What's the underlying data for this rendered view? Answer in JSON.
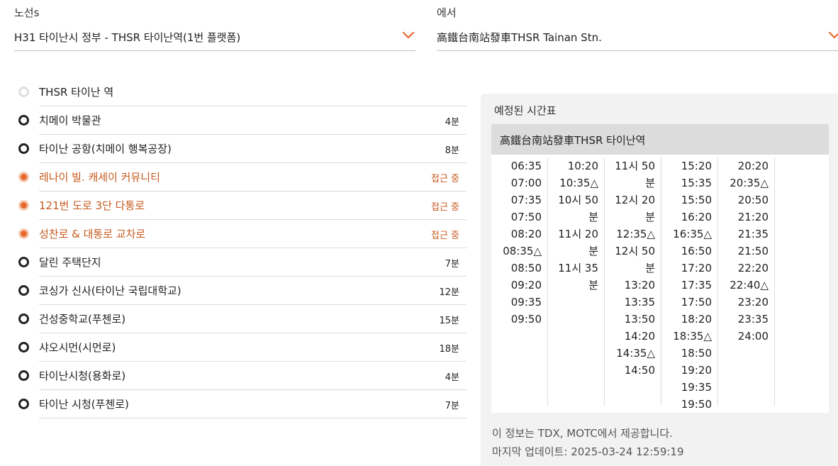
{
  "route_select": {
    "label": "노선s",
    "value": "H31 타이난시 정부 - THSR 타이난역(1번 플랫폼)"
  },
  "from_select": {
    "label": "에서",
    "value": "高鐵台南站發車THSR Tainan Stn."
  },
  "stops": [
    {
      "name": "THSR 타이난 역",
      "eta": "",
      "status": "passed"
    },
    {
      "name": "치메이 박물관",
      "eta": "4분",
      "status": "normal"
    },
    {
      "name": "타이난 공항(치메이 행복공장)",
      "eta": "8분",
      "status": "normal"
    },
    {
      "name": "레나이 빌. 캐세이 커뮤니티",
      "eta": "접근 중",
      "status": "approaching"
    },
    {
      "name": "121번 도로 3단 다통로",
      "eta": "접근 중",
      "status": "approaching"
    },
    {
      "name": "성찬로 & 대통로 교차로",
      "eta": "접근 중",
      "status": "approaching"
    },
    {
      "name": "달린 주택단지",
      "eta": "7분",
      "status": "normal"
    },
    {
      "name": "코싱가 신사(타이난 국립대학교)",
      "eta": "12분",
      "status": "normal"
    },
    {
      "name": "건성중학교(푸첸로)",
      "eta": "15분",
      "status": "normal"
    },
    {
      "name": "샤오시먼(시먼로)",
      "eta": "18분",
      "status": "normal"
    },
    {
      "name": "타이난시청(용화로)",
      "eta": "4분",
      "status": "normal"
    },
    {
      "name": "타이난 시청(푸첸로)",
      "eta": "7분",
      "status": "normal"
    }
  ],
  "timetable": {
    "title": "예정된 시간표",
    "station": "高鐵台南站發車THSR 타이난역",
    "columns": [
      [
        "06:35",
        "07:00",
        "07:35",
        "07:50",
        "08:20",
        "08:35△",
        "08:50",
        "09:20",
        "09:35",
        "09:50"
      ],
      [
        "10:20",
        "10:35△",
        "10시 50",
        "분",
        "11시 20",
        "분",
        "11시 35",
        "분"
      ],
      [
        "11시 50",
        "분",
        "12시 20",
        "분",
        "12:35△",
        "12시 50",
        "분",
        "13:20",
        "13:35",
        "13:50",
        "14:20",
        "14:35△",
        "14:50"
      ],
      [
        "15:20",
        "15:35",
        "15:50",
        "16:20",
        "16:35△",
        "16:50",
        "17:20",
        "17:35",
        "17:50",
        "18:20",
        "18:35△",
        "18:50",
        "19:20",
        "19:35",
        "19:50"
      ],
      [
        "20:20",
        "20:35△",
        "20:50",
        "21:20",
        "21:35",
        "21:50",
        "22:20",
        "22:40△",
        "23:20",
        "23:35",
        "24:00"
      ]
    ]
  },
  "footer": {
    "source": "이 정보는 TDX, MOTC에서 제공합니다.",
    "updated": "마지막 업데이트: 2025-03-24 12:59:19"
  },
  "icons": {
    "dropdown": "chevron-down-icon"
  },
  "colors": {
    "accent": "#e8682e",
    "approaching_text": "#c65a1e",
    "panel_bg": "#f2f2f2"
  }
}
